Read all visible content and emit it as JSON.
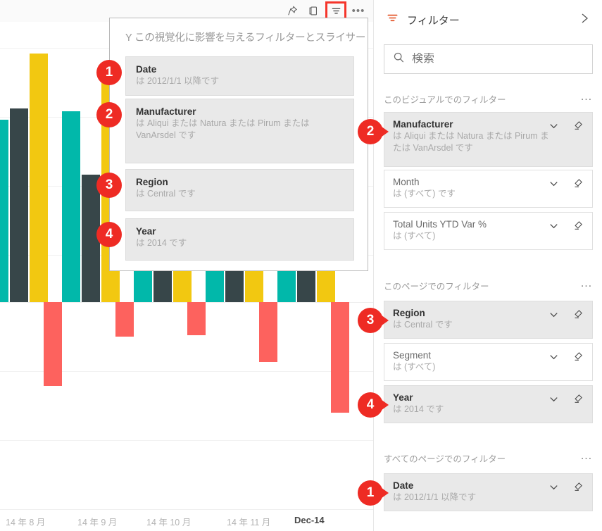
{
  "visual": {
    "toolbar": {
      "pin_label": "pin-visual",
      "focus_label": "focus-mode",
      "filter_label": "filters-affecting-visual",
      "more_label": "•••"
    },
    "popup": {
      "header": "Y この視覚化に影響を与えるフィルターとスライサー",
      "cards": [
        {
          "badge": "1",
          "title": "Date",
          "sub": "は  2012/1/1  以降です"
        },
        {
          "badge": "2",
          "title": "Manufacturer",
          "sub": "は  Aliqui または  Natura または  Pirum または VanArsdel  です"
        },
        {
          "badge": "3",
          "title": "Region",
          "sub": "は  Central です"
        },
        {
          "badge": "4",
          "title": "Year",
          "sub": "は 2014 です"
        }
      ]
    }
  },
  "chart_data": {
    "type": "bar",
    "title": "",
    "xlabel": "",
    "ylabel": "",
    "grid": true,
    "legend": "none",
    "categories": [
      "14 年 8 月",
      "14 年 9 月",
      "14 年 10 月",
      "14 年 11 月",
      "Dec-14"
    ],
    "highlighted_category": "Dec-14",
    "ylim": [
      -220,
      460
    ],
    "series": [
      {
        "name": "teal-series",
        "color": "#01b8aa",
        "values": [
          330,
          345,
          340,
          350,
          400
        ]
      },
      {
        "name": "dark-series",
        "color": "#374649",
        "values": [
          350,
          230,
          240,
          290,
          395
        ]
      },
      {
        "name": "yellow-series",
        "color": "#f2c811",
        "values": [
          450,
          405,
          410,
          405,
          310
        ]
      },
      {
        "name": "red-series",
        "color": "#fd625e",
        "values": [
          -152,
          -62,
          -60,
          -108,
          -200
        ]
      }
    ]
  },
  "filter_pane": {
    "header": {
      "title": "フィルター",
      "filter_icon": "filter-icon",
      "expand_icon": "chevron-right-icon"
    },
    "search": {
      "placeholder": "検索",
      "value": "",
      "icon": "search-icon"
    },
    "sections": [
      {
        "label": "このビジュアルでのフィルター",
        "more": "…",
        "cards": [
          {
            "badge": "2",
            "title": "Manufacturer",
            "sub": "は  Aliqui または  Natura または  Pirum または VanArsdel  です",
            "active": true,
            "muted": false
          },
          {
            "badge": "",
            "title": "Month",
            "sub": "は (すべて) です",
            "active": false,
            "muted": true
          },
          {
            "badge": "",
            "title": "Total Units YTD Var %",
            "sub": "は (すべて)",
            "active": false,
            "muted": true
          }
        ]
      },
      {
        "label": "このページでのフィルター",
        "more": "…",
        "cards": [
          {
            "badge": "3",
            "title": "Region",
            "sub": "は  Central です",
            "active": true,
            "muted": false
          },
          {
            "badge": "",
            "title": "Segment",
            "sub": "は (すべて)",
            "active": false,
            "muted": true
          },
          {
            "badge": "4",
            "title": "Year",
            "sub": "は 2014 です",
            "active": true,
            "muted": false
          }
        ]
      },
      {
        "label": "すべてのページでのフィルター",
        "more": "…",
        "cards": [
          {
            "badge": "1",
            "title": "Date",
            "sub": "は  2012/1/1  以降です",
            "active": true,
            "muted": false
          }
        ]
      }
    ],
    "card_icons": {
      "chevron": "chevron-down-icon",
      "eraser": "eraser-icon"
    }
  },
  "colors": {
    "badge_red": "#ee2b24",
    "teal": "#01b8aa",
    "dark": "#374649",
    "yellow": "#f2c811",
    "red": "#fd625e",
    "highlight_box": "#f5352b"
  }
}
